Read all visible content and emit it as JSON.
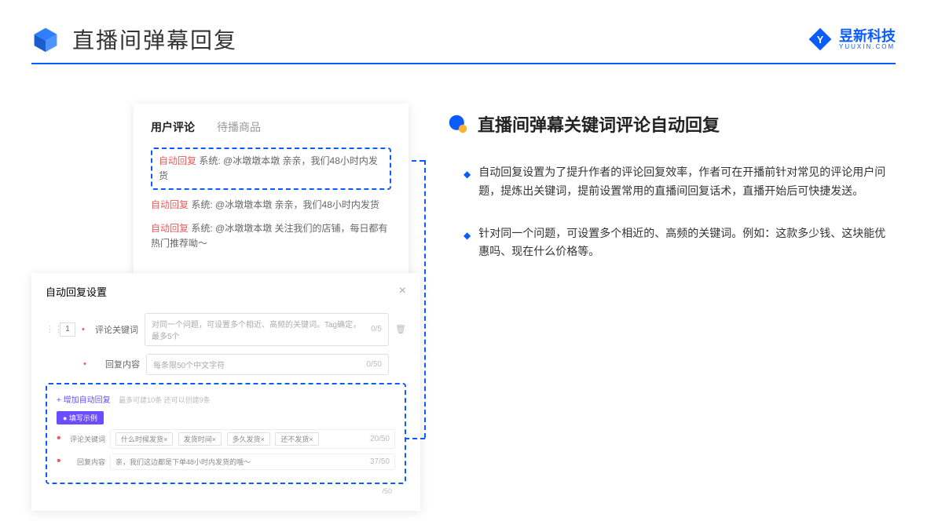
{
  "header": {
    "title": "直播间弹幕回复",
    "brand_name": "昱新科技",
    "brand_sub": "YUUXIN.COM"
  },
  "tabs": {
    "active": "用户评论",
    "inactive": "待播商品"
  },
  "comments": {
    "c1_label": "自动回复",
    "c1_text": " 系统: @冰墩墩本墩 亲亲，我们48小时内发货",
    "c2_label": "自动回复",
    "c2_text": " 系统: @冰墩墩本墩 亲亲，我们48小时内发货",
    "c3_label": "自动回复",
    "c3_text": " 系统: @冰墩墩本墩 关注我们的店铺，每日都有热门推荐呦～"
  },
  "modal": {
    "title": "自动回复设置",
    "index": "1",
    "label_keyword": "评论关键词",
    "placeholder_keyword": "对同一个问题，可设置多个相近、高频的关键词。Tag确定，最多5个",
    "counter_keyword": "0/5",
    "label_content": "回复内容",
    "placeholder_content": "每条限50个中文字符",
    "counter_content": "0/50",
    "add_link": "+ 增加自动回复",
    "add_hint": "最多可建10条 还可以创建9条",
    "example_badge": "● 填写示例",
    "ex_label_kw": "评论关键词",
    "ex_tag1": "什么时候发货×",
    "ex_tag2": "发货时间×",
    "ex_tag3": "多久发货×",
    "ex_tag4": "还不发货×",
    "ex_counter_kw": "20/50",
    "ex_label_ct": "回复内容",
    "ex_content": "亲，我们这边都是下单48小时内发货的哦～",
    "ex_counter_ct": "37/50",
    "trail_counter": "/50"
  },
  "section": {
    "title": "直播间弹幕关键词评论自动回复",
    "bullet1": "自动回复设置为了提升作者的评论回复效率，作者可在开播前针对常见的评论用户问题，提炼出关键词，提前设置常用的直播间回复话术，直播开始后可快捷发送。",
    "bullet2": "针对同一个问题，可设置多个相近的、高频的关键词。例如：这款多少钱、这块能优惠吗、现在什么价格等。"
  }
}
